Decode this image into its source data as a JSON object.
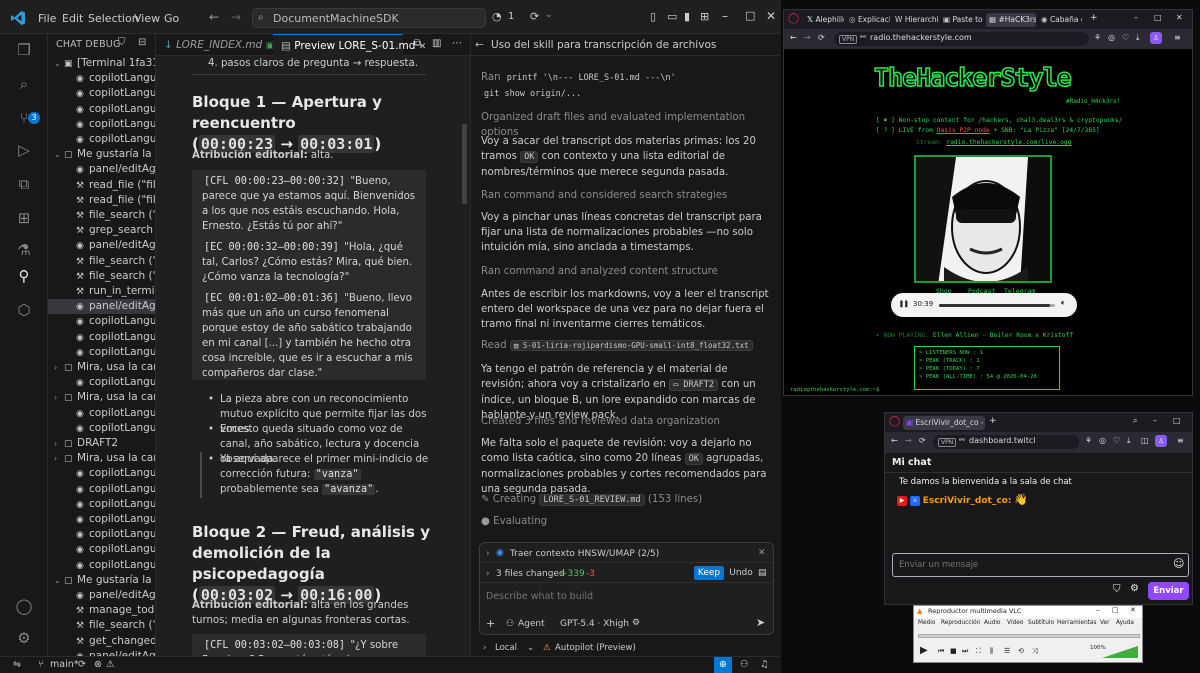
{
  "vscode": {
    "menu": [
      "File",
      "Edit",
      "Selection",
      "View",
      "Go"
    ],
    "command_center": "DocumentMachineSDK",
    "notif_count": "1",
    "activity_badge": "3",
    "sidebar": {
      "header": "CHAT DEBUG",
      "rows": [
        {
          "twisty": "⌄",
          "icon": "▣",
          "label": "[Terminal 1fa318...",
          "indent": 0
        },
        {
          "twisty": "",
          "icon": "◉",
          "label": "copilotLanguag...",
          "indent": 1
        },
        {
          "twisty": "",
          "icon": "◉",
          "label": "copilotLanguag...",
          "indent": 1
        },
        {
          "twisty": "",
          "icon": "◉",
          "label": "copilotLanguag...",
          "indent": 1
        },
        {
          "twisty": "",
          "icon": "◉",
          "label": "copilotLanguag...",
          "indent": 1
        },
        {
          "twisty": "",
          "icon": "◉",
          "label": "copilotLanguag...",
          "indent": 1
        },
        {
          "twisty": "⌄",
          "icon": "▢",
          "label": "Me gustaría la o...",
          "indent": 0
        },
        {
          "twisty": "",
          "icon": "◉",
          "label": "panel/editAge...",
          "indent": 1
        },
        {
          "twisty": "",
          "icon": "⚒",
          "label": "read_file  (\"fileP...",
          "indent": 1
        },
        {
          "twisty": "",
          "icon": "⚒",
          "label": "read_file  (\"fileP...",
          "indent": 1
        },
        {
          "twisty": "",
          "icon": "⚒",
          "label": "file_search  (\"q...",
          "indent": 1
        },
        {
          "twisty": "",
          "icon": "⚒",
          "label": "grep_search  (\"...",
          "indent": 1
        },
        {
          "twisty": "",
          "icon": "◉",
          "label": "panel/editAge...",
          "indent": 1
        },
        {
          "twisty": "",
          "icon": "⚒",
          "label": "file_search  (\"qu...",
          "indent": 1
        },
        {
          "twisty": "",
          "icon": "⚒",
          "label": "file_search  (\"qu...",
          "indent": 1
        },
        {
          "twisty": "",
          "icon": "⚒",
          "label": "run_in_termina...",
          "indent": 1
        },
        {
          "twisty": "",
          "icon": "◉",
          "label": "panel/editAge...",
          "indent": 1,
          "selected": true
        },
        {
          "twisty": "",
          "icon": "◉",
          "label": "copilotLanguag...",
          "indent": 1
        },
        {
          "twisty": "",
          "icon": "◉",
          "label": "copilotLanguag...",
          "indent": 1
        },
        {
          "twisty": "",
          "icon": "◉",
          "label": "copilotLanguag...",
          "indent": 1
        },
        {
          "twisty": "›",
          "icon": "▢",
          "label": "Mira, usa la carp...",
          "indent": 0
        },
        {
          "twisty": "",
          "icon": "◉",
          "label": "copilotLanguag...",
          "indent": 1
        },
        {
          "twisty": "›",
          "icon": "▢",
          "label": "Mira, usa la carp...",
          "indent": 0
        },
        {
          "twisty": "",
          "icon": "◉",
          "label": "copilotLanguag...",
          "indent": 1
        },
        {
          "twisty": "",
          "icon": "◉",
          "label": "copilotLanguag...",
          "indent": 1
        },
        {
          "twisty": "›",
          "icon": "▢",
          "label": "DRAFT2",
          "indent": 0
        },
        {
          "twisty": "›",
          "icon": "▢",
          "label": "Mira, usa la carp...",
          "indent": 0
        },
        {
          "twisty": "",
          "icon": "◉",
          "label": "copilotLanguag...",
          "indent": 1
        },
        {
          "twisty": "",
          "icon": "◉",
          "label": "copilotLanguag...",
          "indent": 1
        },
        {
          "twisty": "",
          "icon": "◉",
          "label": "copilotLanguag...",
          "indent": 1
        },
        {
          "twisty": "",
          "icon": "◉",
          "label": "copilotLanguag...",
          "indent": 1
        },
        {
          "twisty": "",
          "icon": "◉",
          "label": "copilotLanguag...",
          "indent": 1
        },
        {
          "twisty": "",
          "icon": "◉",
          "label": "copilotLanguag...",
          "indent": 1
        },
        {
          "twisty": "",
          "icon": "◉",
          "label": "copilotLanguag...",
          "indent": 1
        },
        {
          "twisty": "⌄",
          "icon": "▢",
          "label": "Me gustaría la o...",
          "indent": 0
        },
        {
          "twisty": "",
          "icon": "◉",
          "label": "panel/editAge...",
          "indent": 1
        },
        {
          "twisty": "",
          "icon": "⚒",
          "label": "manage_todo_l...",
          "indent": 1
        },
        {
          "twisty": "",
          "icon": "⚒",
          "label": "file_search  (\"qu...",
          "indent": 1
        },
        {
          "twisty": "",
          "icon": "⚒",
          "label": "get_changed_fi...",
          "indent": 1
        },
        {
          "twisty": "",
          "icon": "◉",
          "label": "panel/editAge...",
          "indent": 1
        }
      ]
    },
    "tabs": [
      {
        "label": "LORE_INDEX.md",
        "active": false
      },
      {
        "label": "Preview LORE_S-01.md",
        "active": true
      }
    ],
    "preview": {
      "top_item": "4. pasos claros de pregunta → respuesta.",
      "h1_title": "Bloque 1 — Apertura y reencuentro",
      "h1_t1": "00:00:23",
      "h1_t2": "00:03:01",
      "attr_label": "Atribución editorial:",
      "attr1": " alta.",
      "q1": [
        {
          "code": "[CFL 00:00:23–00:00:32]",
          "text": " \"Bueno, parece que ya estamos aquí. Bienvenidos a los que nos estáis escuchando. Hola, Ernesto. ¿Estás tú por ahí?\""
        },
        {
          "code": "[EC 00:00:32–00:00:39]",
          "text": " \"Hola, ¿qué tal, Carlos? ¿Cómo estás? Mira, qué bien. ¿Cómo vanza la tecnología?\""
        },
        {
          "code": "[EC 00:01:02–00:01:36]",
          "text": " \"Bueno, llevo más que un año un curso fenomenal porque estoy de año sabático trabajando en mi canal [...] y también he hecho otra cosa increíble, que es ir a escuchar a mis compañeros dar clase.\""
        }
      ],
      "bullets": [
        "La pieza abre con un reconocimiento mutuo explícito que permite fijar las dos voces.",
        "Ernesto queda situado como voz de canal, año sabático, lectura y docencia observada.",
        "Ya aquí aparece el primer mini-indicio de corrección futura: "
      ],
      "b3_code1": "\"vanza\"",
      "b3_mid": " probablemente sea ",
      "b3_code2": "\"avanza\"",
      "b3_end": ".",
      "h2_title": "Bloque 2 — Freud, análisis y demolición de la psicopedagogía",
      "h2_t1": "00:03:02",
      "h2_t2": "00:16:00",
      "attr2": " alta en los grandes turnos; media en algunas fronteras cortas.",
      "q2_code": "[CFL 00:03:02–00:03:08]",
      "q2_text": " \"¿Y sobre Freud, no? Porque tú estás ahora trabajando a Freud o en qué andas exactamente ahora mismo.\"",
      "arrow": "→"
    },
    "chat": {
      "header": "Uso del skill para transcripción de archivos",
      "ran1_prefix": "Ran ",
      "ran1_code": "printf '\\n--- LORE_S-01.md ---\\n'",
      "ran1_code2": "git show origin/...",
      "s1_dim": "Organized",
      "s1_rest": " draft files and evaluated implementation options",
      "p1": "Voy a sacar del transcript dos materias primas: los 20 tramos ",
      "p1_chip": "OK",
      "p1_end": " con contexto y una lista editorial de nombres/términos que merece segunda pasada.",
      "s2_dim": "Ran",
      "s2_rest": " command and considered search strategies",
      "p2": "Voy a pinchar unas líneas concretas del transcript para fijar una lista de normalizaciones probables —no solo intuición mía, sino anclada a timestamps.",
      "s3_dim": "Ran",
      "s3_rest": " command and analyzed content structure",
      "p3": "Antes de escribir los markdowns, voy a leer el transcript entero del workspace de una vez para no dejar fuera el tramo final ni inventarme cierres temáticos.",
      "read_prefix": "Read",
      "read_file": "S-01-liria-rojipardismo-GPU-small-int8_float32.txt",
      "p4a": "Ya tengo el patrón de referencia y el material de revisión; ahora voy a cristalizarlo en ",
      "p4_chip": "DRAFT2",
      "p4b": " con un índice, un bloque B, un lore expandido con marcas de hablante y un review pack.",
      "s4_dim": "Created",
      "s4_rest": " 3 files and reviewed data organization",
      "p5": "Me falta solo el paquete de revisión: voy a dejarlo no como lista caótica, sino como 20 líneas ",
      "p5_chip": "OK",
      "p5_end": " agrupadas, normalizaciones probables y cortes recomendados para una segunda pasada.",
      "creating_prefix": "Creating",
      "creating_file": "LORE_S-01_REVIEW.md",
      "creating_lines": "(153 lines)",
      "evaluating": "Evaluating",
      "todo": "Traer contexto HNSW/UMAP (2/5)",
      "files_changed": "3 files changed",
      "added": "+339",
      "removed": "-3",
      "keep": "Keep",
      "undo": "Undo",
      "placeholder": "Describe what to build",
      "agent": "Agent",
      "model": "GPT-5.4 · Xhigh",
      "local": "Local",
      "autopilot": "Autopilot (Preview)"
    },
    "status": {
      "branch": "main*"
    }
  },
  "radio_browser": {
    "tabs": [
      "Alephillo on",
      "Explicación",
      "Hierarchical",
      "Paste to Ma",
      "#HaCK3rs_R4d1",
      "Cabaña com"
    ],
    "active_tab": 4,
    "url": "radio.thehackerstyle.com",
    "logo": "TheHackerStyle",
    "logo_sub": "#Radio_H4ck3rs!",
    "line1": "[ ✖ ] Non-stop content for /hackers, chal3.deal3rs & cryptopunks/",
    "line2_a": "[ ? ] LIVE from ",
    "line2_link": "Oasis P2P node",
    "line2_b": " + SNB: \"La Pizza\" [24/7/365]",
    "stream_label": "Stream: ",
    "stream_link": "radio.thehackerstyle.com/live.ogg",
    "links": [
      "Shop",
      "Podcast",
      "Telegram"
    ],
    "player_time": "30:39",
    "player_progress": 0.96,
    "now_playing_label": "▸ NOW PLAYING: ",
    "now_playing": "Ellen Allien - Boiler Room x Kristoff",
    "stats": [
      "> LISTENERS NOW  : 1",
      "> PEAK (TRACK)   : 1",
      "> PEAK (TODAY)   : 7",
      "> PEAK (ALL-TIME) : 54 @ 2026-04-26"
    ],
    "footer": "radio@thehackerstyle.com:~$"
  },
  "chat_browser": {
    "tab": "EscriVivir_dot_co - Chat",
    "url": "dashboard.twitcl",
    "title": "Mi chat",
    "welcome": "Te damos la bienvenida a la sala de chat",
    "user": "EscriVivir_dot_co:",
    "placeholder": "Enviar un mensaje",
    "send": "Enviar"
  },
  "vlc": {
    "title": "Reproductor multimedia VLC",
    "menu": [
      "Medio",
      "Reproducción",
      "Audio",
      "Vídeo",
      "Subtítulo",
      "Herramientas",
      "Ver",
      "Ayuda"
    ],
    "volume": "100%"
  }
}
